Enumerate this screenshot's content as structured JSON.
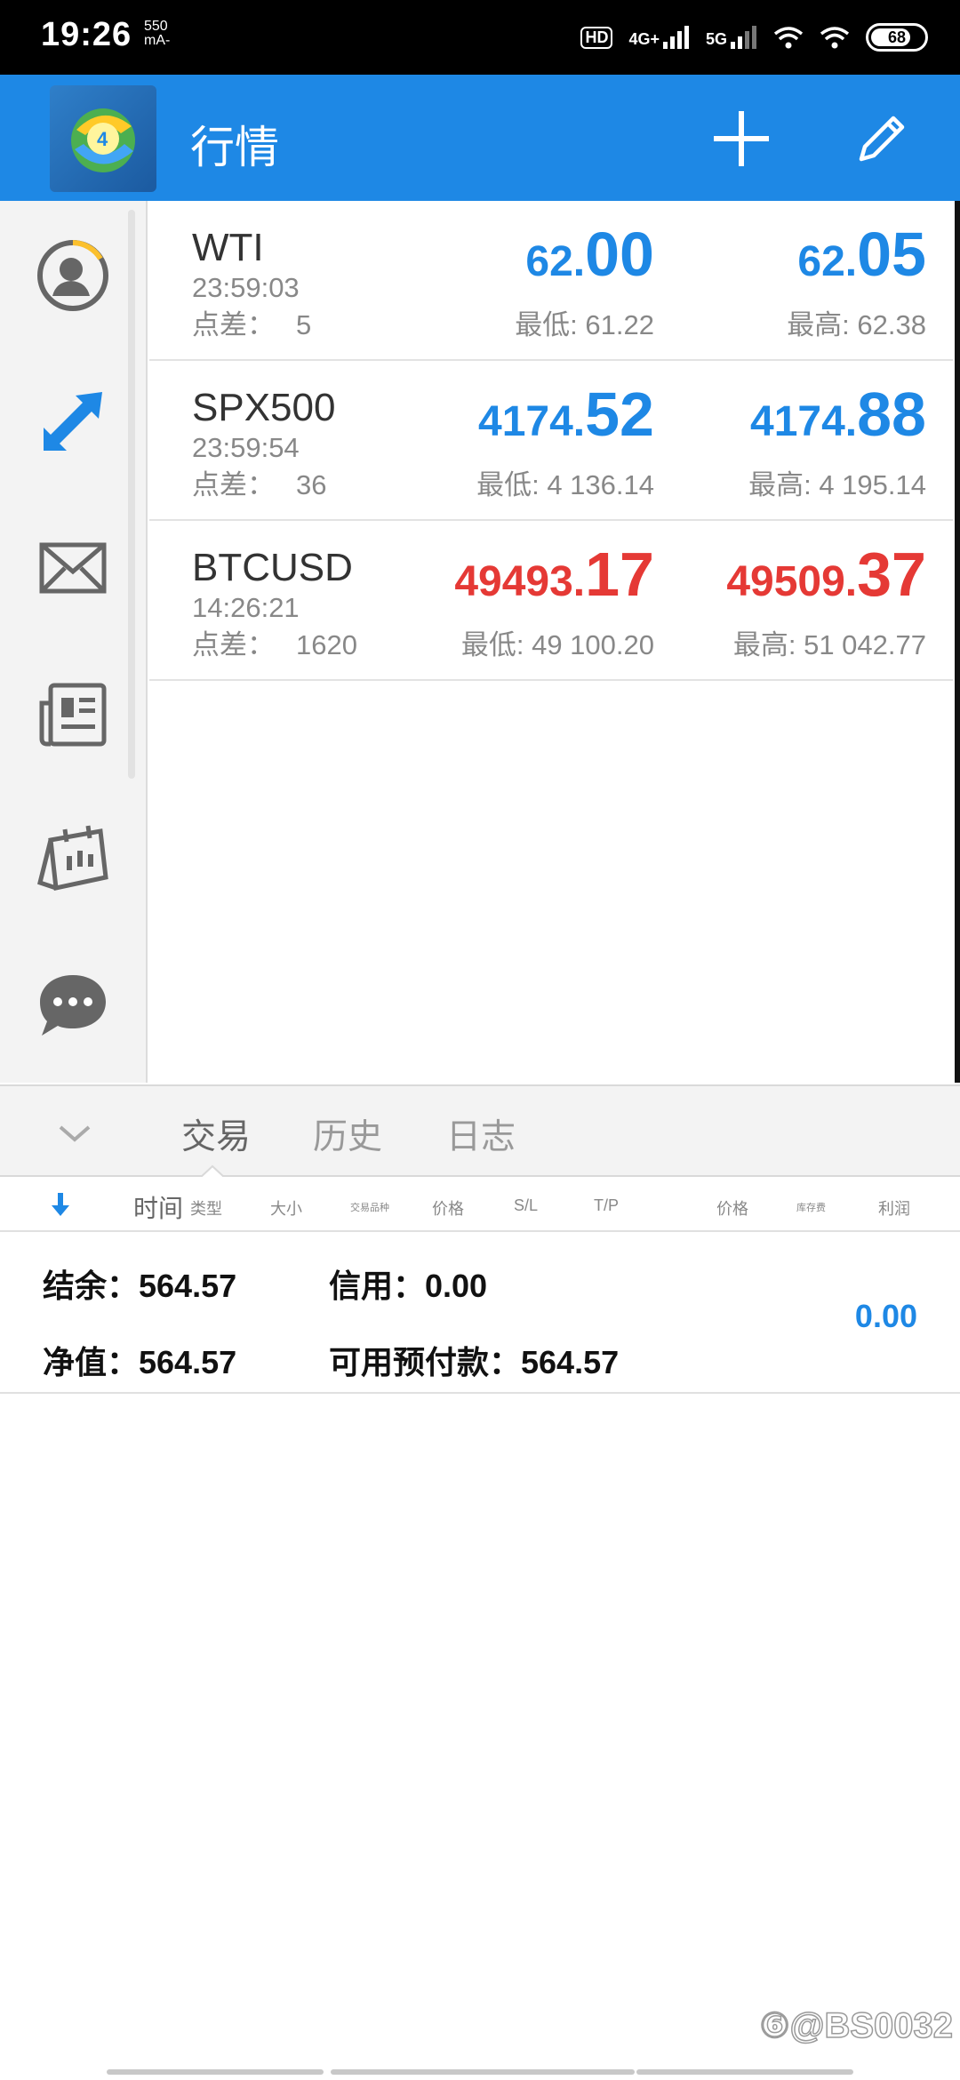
{
  "status_bar": {
    "time": "19:26",
    "rate_value": "550",
    "rate_unit": "mA-",
    "hd": "HD",
    "net1": "4G+",
    "net2": "5G",
    "battery": "68"
  },
  "toolbar": {
    "title": "行情"
  },
  "quotes": [
    {
      "symbol": "WTI",
      "time": "23:59:03",
      "spread_label": "点差：",
      "spread": "5",
      "bid_main": "62.",
      "bid_big": "00",
      "ask_main": "62.",
      "ask_big": "05",
      "low": "最低: 61.22",
      "high": "最高: 62.38",
      "color": "#1e88e5"
    },
    {
      "symbol": "SPX500",
      "time": "23:59:54",
      "spread_label": "点差：",
      "spread": "36",
      "bid_main": "4174.",
      "bid_big": "52",
      "ask_main": "4174.",
      "ask_big": "88",
      "low": "最低: 4 136.14",
      "high": "最高: 4 195.14",
      "color": "#1e88e5"
    },
    {
      "symbol": "BTCUSD",
      "time": "14:26:21",
      "spread_label": "点差：",
      "spread": "1620",
      "bid_main": "49493.",
      "bid_big": "17",
      "ask_main": "49509.",
      "ask_big": "37",
      "low": "最低: 49 100.20",
      "high": "最高: 51 042.77",
      "color": "#e53935"
    }
  ],
  "tabs": [
    {
      "label": "交易"
    },
    {
      "label": "历史"
    },
    {
      "label": "日志"
    }
  ],
  "columns": {
    "time": "时间",
    "type": "类型",
    "size": "大小",
    "symbol": "交易品种",
    "price": "价格",
    "sl": "S/L",
    "tp": "T/P",
    "price2": "价格",
    "swap": "库存费",
    "profit": "利润"
  },
  "summary": {
    "balance": "结余：564.57",
    "credit": "信用：0.00",
    "equity": "净值：564.57",
    "free_margin": "可用预付款：564.57",
    "profit": "0.00"
  },
  "watermark": "⑥@BS0032"
}
